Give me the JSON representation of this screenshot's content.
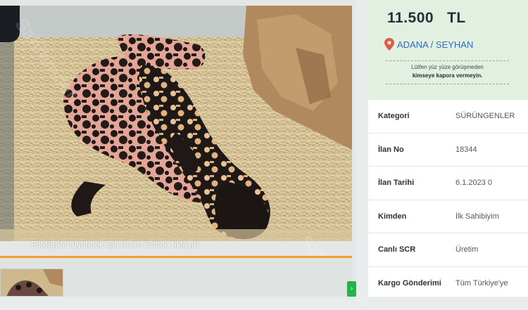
{
  "gallery": {
    "hint": "Fotoğrafı büyütmek için resim üstüne tıklayın",
    "watermark": "Sahibinden",
    "next_icon": "chevron-right-icon"
  },
  "listing": {
    "price": "11.500   TL",
    "location": "ADANA / SEYHAN",
    "notice_line1": "Lütfen yüz yüze görüşmeden",
    "notice_line2": "kimseye kapora vermeyin.",
    "details": [
      {
        "label": "Kategori",
        "value": "SÜRÜNGENLER"
      },
      {
        "label": "İlan No",
        "value": "18344"
      },
      {
        "label": "İlan Tarihi",
        "value": "6.1.2023 0"
      },
      {
        "label": "Kimden",
        "value": "İlk Sahibiyim"
      },
      {
        "label": "Canlı SCR",
        "value": "Üretim"
      },
      {
        "label": "Kargo Gönderimi",
        "value": "Tüm Türkiye'ye"
      }
    ]
  },
  "colors": {
    "accent_orange": "#f0a02a",
    "price_box_bg": "#e2f0e1",
    "location_blue": "#2f6fb8",
    "pin_red": "#e05a4a",
    "next_green": "#24b24a"
  }
}
